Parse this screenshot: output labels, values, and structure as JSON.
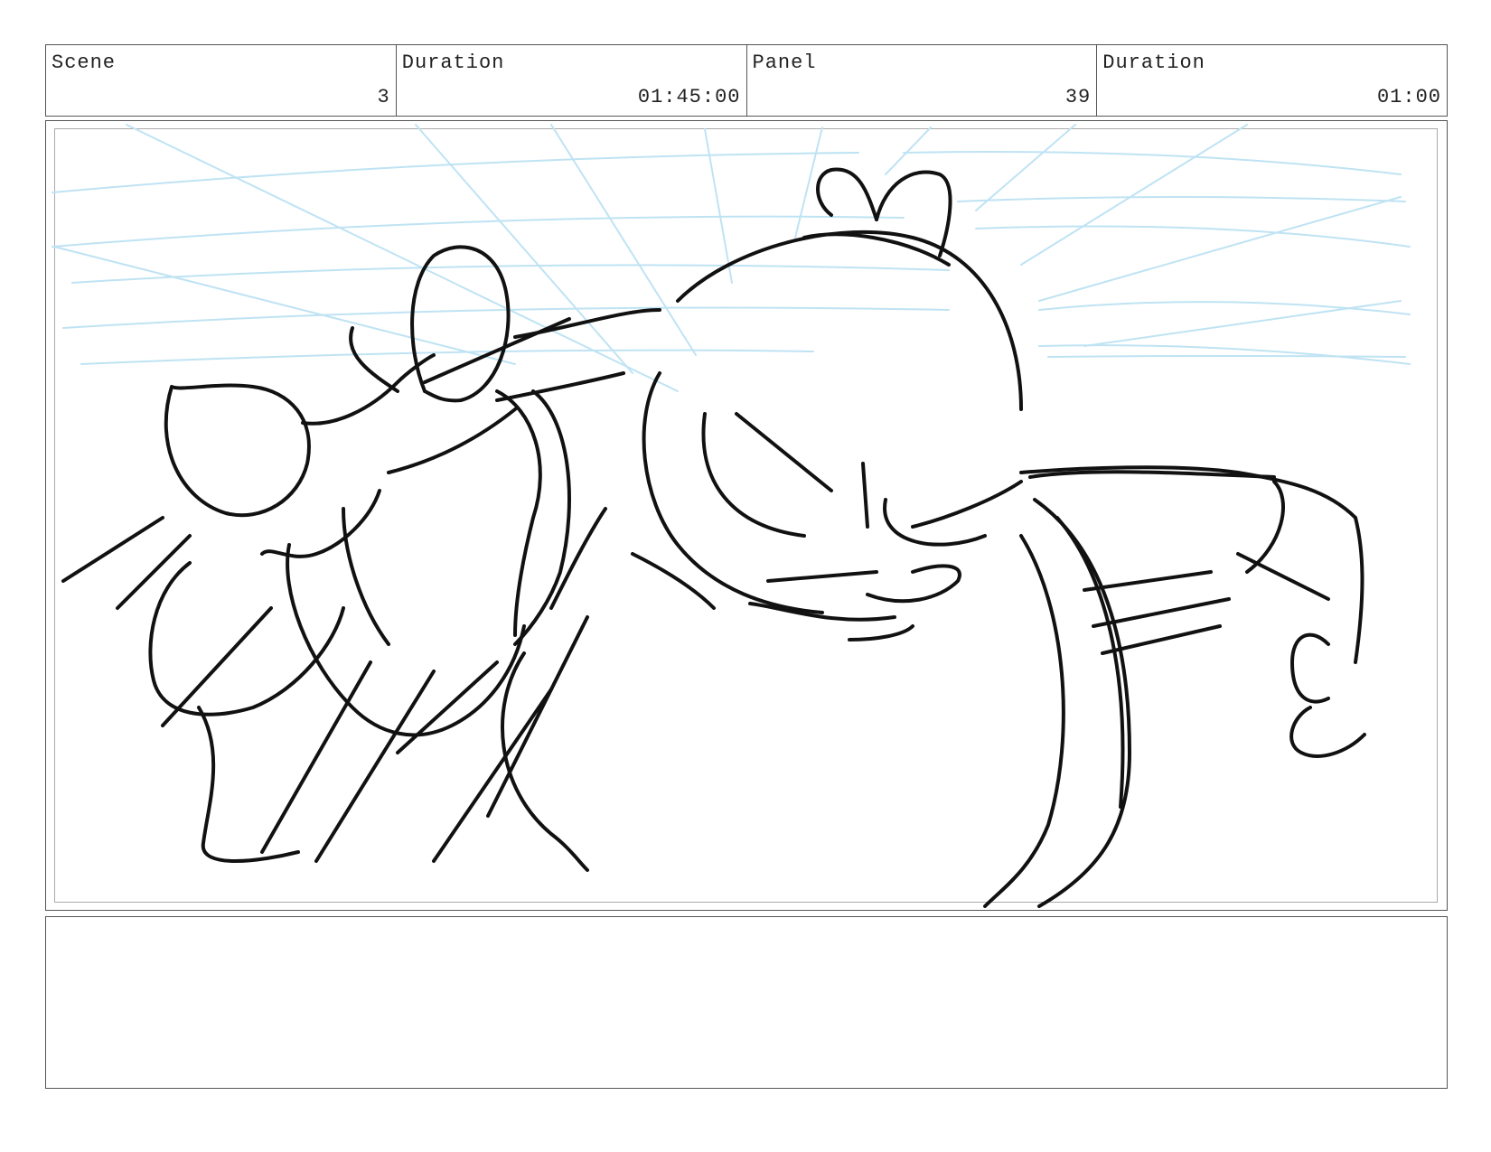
{
  "header": {
    "scene_label": "Scene",
    "scene_value": "3",
    "duration_label": "Duration",
    "duration_value": "01:45:00",
    "panel_label": "Panel",
    "panel_value": "39",
    "panel_duration_label": "Duration",
    "panel_duration_value": "01:00"
  },
  "notes": {
    "text": ""
  },
  "colors": {
    "sketch": "#111111",
    "guides": "#bfe3f3",
    "border": "#555555"
  }
}
